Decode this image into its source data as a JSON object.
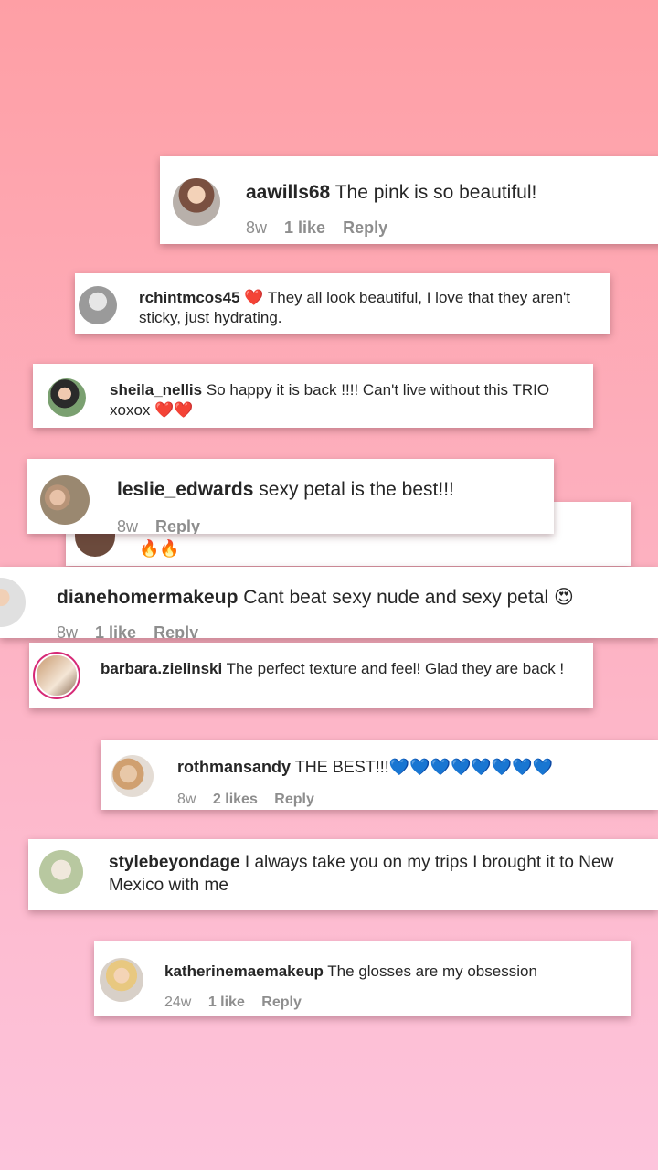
{
  "comments": [
    {
      "user": "aawills68",
      "text": "The pink is so beautiful!",
      "age": "8w",
      "likes": "1 like",
      "reply": "Reply"
    },
    {
      "user": "rchintmcos45",
      "text": "❤️ They all look beautiful, I love that they aren't sticky, just hydrating."
    },
    {
      "user": "sheila_nellis",
      "text": "So happy it is back !!!! Can't live without this TRIO xoxox ❤️❤️"
    },
    {
      "user": "leslie_edwards",
      "text": "sexy petal is the best!!!",
      "age": "8w",
      "reply": "Reply"
    },
    {
      "text": "🔥🔥"
    },
    {
      "user": "dianehomermakeup",
      "text": "Cant beat sexy nude and sexy petal 😍",
      "age": "8w",
      "likes": "1 like",
      "reply": "Reply"
    },
    {
      "user": "barbara.zielinski",
      "text": "The perfect texture and feel! Glad they are back !"
    },
    {
      "user": "rothmansandy",
      "text": "THE BEST!!!💙💙💙💙💙💙💙💙",
      "age": "8w",
      "likes": "2 likes",
      "reply": "Reply"
    },
    {
      "user": "stylebeyondage",
      "text": "I always take you on my trips I brought it to New Mexico with me"
    },
    {
      "user": "katherinemaemakeup",
      "text": "The glosses are my obsession",
      "age": "24w",
      "likes": "1 like",
      "reply": "Reply"
    }
  ]
}
